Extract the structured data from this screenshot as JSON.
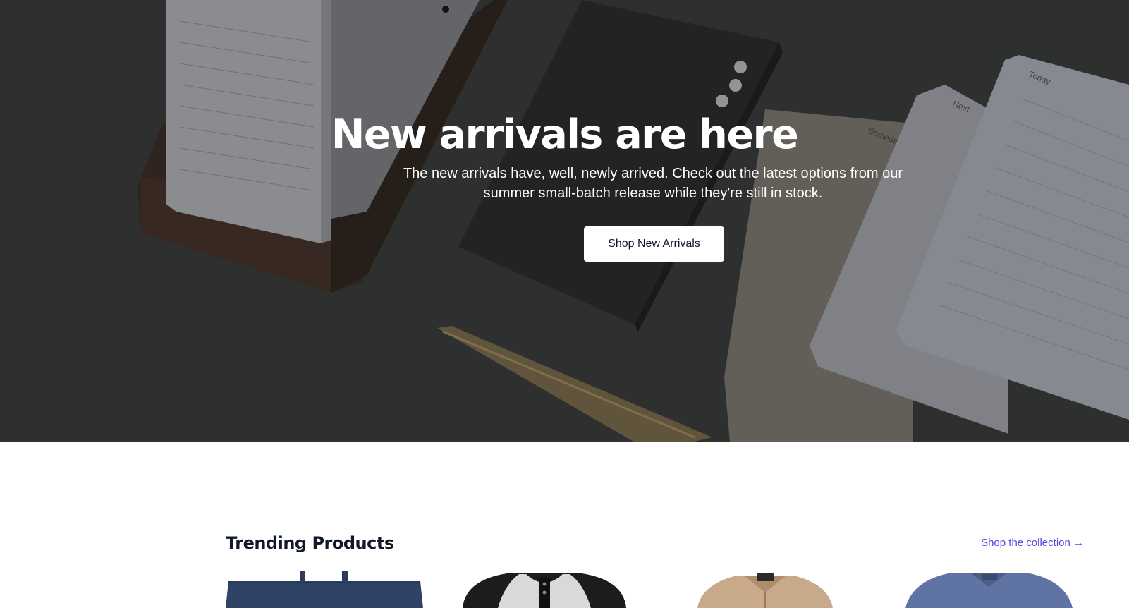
{
  "hero": {
    "title": "New arrivals are here",
    "subtitle": "The new arrivals have, well, newly arrived. Check out the latest options from our summer small-batch release while they're still in stock.",
    "cta_label": "Shop New Arrivals",
    "card_labels": [
      "Today",
      "Next",
      "Someday"
    ]
  },
  "trending": {
    "title": "Trending Products",
    "link_label": "Shop the collection →",
    "products": [
      {
        "name": "navy-tote-bag"
      },
      {
        "name": "raglan-henley-shirt"
      },
      {
        "name": "tan-jacket"
      },
      {
        "name": "blue-vneck-tee"
      }
    ]
  },
  "colors": {
    "accent": "#4f46e5",
    "heading": "#111827",
    "hero_bg": "#3c3e3d"
  }
}
